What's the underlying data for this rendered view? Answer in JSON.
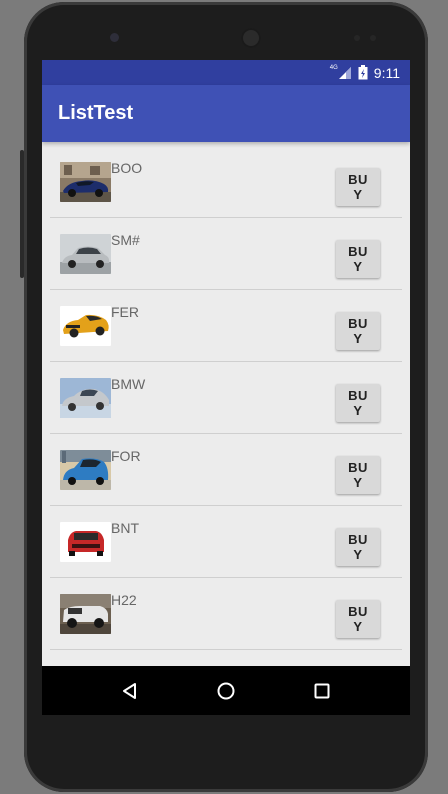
{
  "status": {
    "network": "4G",
    "time": "9:11"
  },
  "app": {
    "title": "ListTest"
  },
  "items": [
    {
      "name": "BOO",
      "button": "BUY",
      "image": "car-photo-blue-sports"
    },
    {
      "name": "SM#",
      "button": "BUY",
      "image": "car-photo-silver-sedan"
    },
    {
      "name": "FER",
      "button": "BUY",
      "image": "car-photo-yellow-camaro"
    },
    {
      "name": "BMW",
      "button": "BUY",
      "image": "car-photo-silver-coupe"
    },
    {
      "name": "FOR",
      "button": "BUY",
      "image": "car-photo-blue-hatchback"
    },
    {
      "name": "BNT",
      "button": "BUY",
      "image": "car-photo-red-suv"
    },
    {
      "name": "H22",
      "button": "BUY",
      "image": "car-photo-white-truck"
    }
  ],
  "navbar": {
    "icons": [
      "back-icon",
      "home-icon",
      "recents-icon"
    ]
  },
  "colors": {
    "appbar": "#3f51b5",
    "statusbar": "#303f9f",
    "background": "#ececec"
  }
}
